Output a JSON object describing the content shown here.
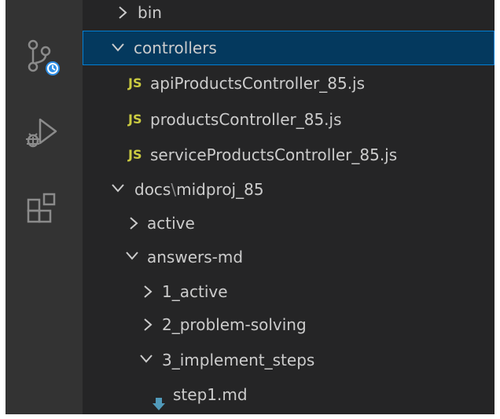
{
  "activity_bar": {
    "icons": [
      "source-control-icon",
      "run-debug-icon",
      "extensions-icon"
    ]
  },
  "explorer": {
    "rows": [
      {
        "label": "bin",
        "type": "folder",
        "expanded": false
      },
      {
        "label": "controllers",
        "type": "folder",
        "expanded": true,
        "selected": true
      },
      {
        "label": "apiProductsController_85.js",
        "type": "file",
        "icon": "JS"
      },
      {
        "label": "productsController_85.js",
        "type": "file",
        "icon": "JS"
      },
      {
        "label": "serviceProductsController_85.js",
        "type": "file",
        "icon": "JS"
      },
      {
        "label_parts": [
          "docs",
          "\\",
          "midproj_85"
        ],
        "type": "folder",
        "expanded": true
      },
      {
        "label": "active",
        "type": "folder",
        "expanded": false
      },
      {
        "label": "answers-md",
        "type": "folder",
        "expanded": true
      },
      {
        "label": "1_active",
        "type": "folder",
        "expanded": false
      },
      {
        "label": "2_problem-solving",
        "type": "folder",
        "expanded": false
      },
      {
        "label": "3_implement_steps",
        "type": "folder",
        "expanded": true
      },
      {
        "label": "step1.md",
        "type": "file",
        "icon": "markdown-icon"
      }
    ]
  },
  "colors": {
    "background": "#252526",
    "activity_bar": "#333333",
    "selection_bg": "#04395e",
    "selection_border": "#007fd4",
    "js_badge": "#cbcb41",
    "md_icon": "#519aba",
    "text": "#cccccc"
  }
}
